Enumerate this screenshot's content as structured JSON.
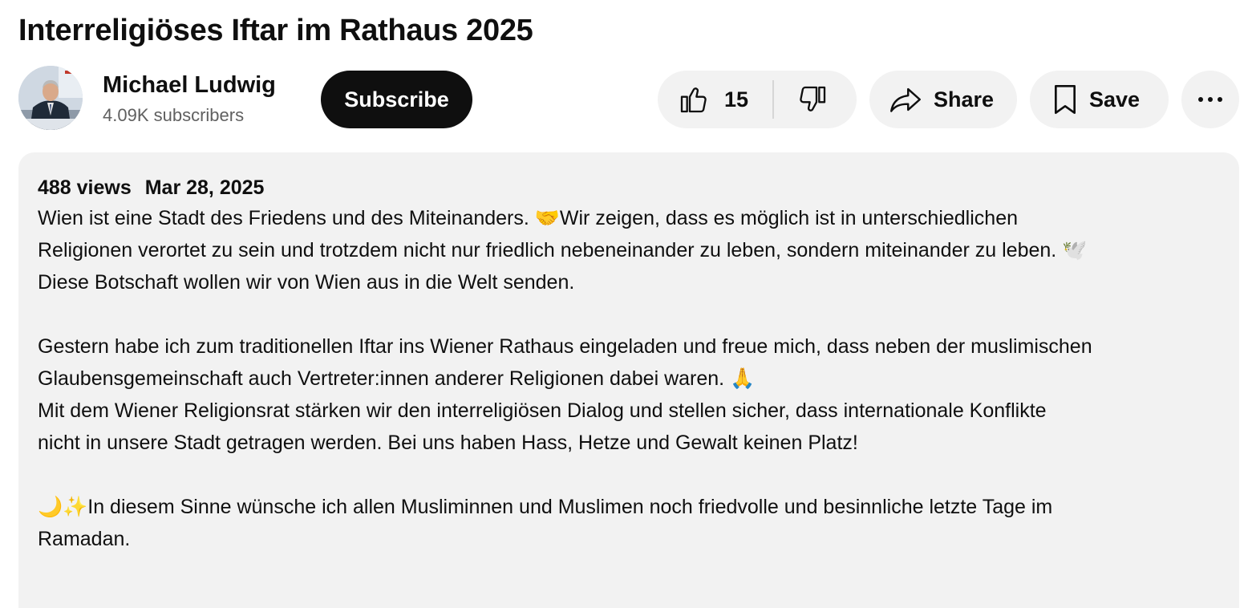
{
  "video": {
    "title": "Interreligiöses Iftar im Rathaus 2025"
  },
  "channel": {
    "name": "Michael Ludwig",
    "subscribers": "4.09K subscribers",
    "subscribe_label": "Subscribe",
    "avatar_icon": "avatar-photo"
  },
  "actions": {
    "like_count": "15",
    "share_label": "Share",
    "save_label": "Save",
    "icons": {
      "like": "thumbs-up-icon",
      "dislike": "thumbs-down-icon",
      "share": "share-arrow-icon",
      "save": "bookmark-icon",
      "more": "more-horizontal-icon"
    }
  },
  "description": {
    "views": "488 views",
    "date": "Mar 28, 2025",
    "lines": [
      "Wien ist eine Stadt des Friedens und des Miteinanders. 🤝Wir zeigen, dass es möglich ist in unterschiedlichen",
      "Religionen verortet zu sein und trotzdem nicht nur friedlich nebeneinander zu leben, sondern miteinander zu leben. 🕊️",
      "Diese Botschaft wollen wir von Wien aus in die Welt senden.",
      "",
      "Gestern habe ich zum traditionellen Iftar ins Wiener Rathaus eingeladen und freue mich, dass neben der muslimischen",
      "Glaubensgemeinschaft auch Vertreter:innen anderer Religionen dabei waren. 🙏",
      "Mit dem Wiener Religionsrat stärken wir den interreligiösen Dialog und stellen sicher, dass internationale Konflikte",
      "nicht in unsere Stadt getragen werden. Bei uns haben Hass, Hetze und Gewalt keinen Platz!",
      "",
      "🌙✨In diesem Sinne wünsche ich allen Musliminnen und Muslimen noch friedvolle und besinnliche letzte Tage im",
      "Ramadan."
    ]
  },
  "colors": {
    "text_primary": "#0f0f0f",
    "text_secondary": "#606060",
    "subscribe_bg": "#0f0f0f",
    "pill_bg": "#f2f2f2",
    "description_bg": "#f2f2f2"
  }
}
